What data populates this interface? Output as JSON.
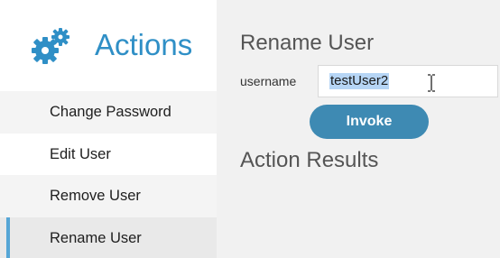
{
  "sidebar": {
    "title": "Actions",
    "icon": "gears-icon",
    "accent_color": "#2f8fc6",
    "items": [
      {
        "label": "Change Password",
        "active": false
      },
      {
        "label": "Edit User",
        "active": false
      },
      {
        "label": "Remove User",
        "active": false
      },
      {
        "label": "Rename User",
        "active": true
      }
    ]
  },
  "main": {
    "title": "Rename User",
    "form": {
      "label": "username",
      "value": "testUser2",
      "value_selected": true
    },
    "invoke_label": "Invoke",
    "invoke_color": "#3e8ab3",
    "results_title": "Action Results"
  }
}
